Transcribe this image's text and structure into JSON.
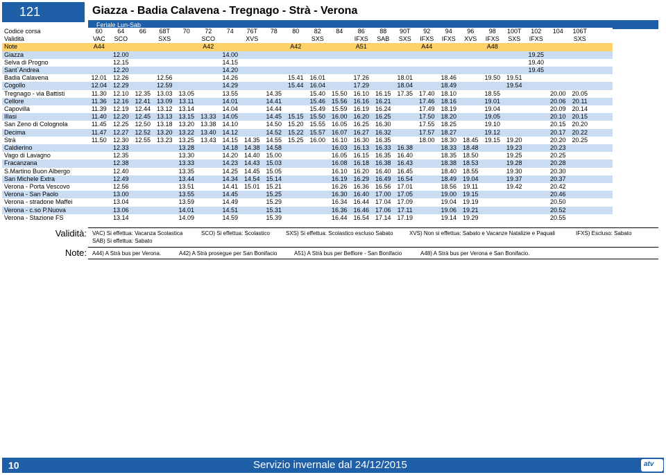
{
  "header": {
    "route_number": "121",
    "title": "Giazza - Badia Calavena - Tregnago - Strà - Verona",
    "service_days": "Feriale Lun-Sab"
  },
  "labels": {
    "course_code": "Codice corsa",
    "validity": "Validità",
    "notes": "Note"
  },
  "columns": 24,
  "course_codes": [
    "60",
    "64",
    "66",
    "68T",
    "70",
    "72",
    "74",
    "76T",
    "78",
    "80",
    "82",
    "84",
    "86",
    "88",
    "90T",
    "92",
    "94",
    "96",
    "98",
    "100T",
    "102",
    "104",
    "106T",
    ""
  ],
  "validity_row": [
    "VAC",
    "SCO",
    "",
    "SXS",
    "",
    "SCO",
    "",
    "XVS",
    "",
    "",
    "SXS",
    "",
    "IFXS",
    "SAB",
    "SXS",
    "IFXS",
    "IFXS",
    "XVS",
    "IFXS",
    "SXS",
    "IFXS",
    "",
    "SXS",
    ""
  ],
  "notes_row": [
    "A44",
    "",
    "",
    "",
    "",
    "A42",
    "",
    "",
    "",
    "A42",
    "",
    "",
    "A51",
    "",
    "",
    "A44",
    "",
    "",
    "A48",
    "",
    "",
    "",
    "",
    ""
  ],
  "stops": [
    {
      "name": "Giazza",
      "times": [
        "",
        "12.00",
        "",
        "",
        "",
        "",
        "14.00",
        "",
        "",
        "",
        "",
        "",
        "",
        "",
        "",
        "",
        "",
        "",
        "",
        "",
        "19.25",
        "",
        "",
        ""
      ]
    },
    {
      "name": "Selva di Progno",
      "times": [
        "",
        "12.15",
        "",
        "",
        "",
        "",
        "14.15",
        "",
        "",
        "",
        "",
        "",
        "",
        "",
        "",
        "",
        "",
        "",
        "",
        "",
        "19.40",
        "",
        "",
        ""
      ]
    },
    {
      "name": "Sant`Andrea",
      "times": [
        "",
        "12.20",
        "",
        "",
        "",
        "",
        "14.20",
        "",
        "",
        "",
        "",
        "",
        "",
        "",
        "",
        "",
        "",
        "",
        "",
        "",
        "19.45",
        "",
        "",
        ""
      ]
    },
    {
      "name": "Badia Calavena",
      "times": [
        "12.01",
        "12.26",
        "",
        "12.56",
        "",
        "",
        "14.26",
        "",
        "",
        "15.41",
        "16.01",
        "",
        "17.26",
        "",
        "18.01",
        "",
        "18.46",
        "",
        "19.50",
        "19.51",
        "",
        "",
        "",
        ""
      ]
    },
    {
      "name": "Cogollo",
      "times": [
        "12.04",
        "12.29",
        "",
        "12.59",
        "",
        "",
        "14.29",
        "",
        "",
        "15.44",
        "16.04",
        "",
        "17.29",
        "",
        "18.04",
        "",
        "18.49",
        "",
        "",
        "19.54",
        "",
        "",
        "",
        ""
      ]
    },
    {
      "name": "Tregnago - via Battisti",
      "times": [
        "11.30",
        "12.10",
        "12.35",
        "13.03",
        "13.05",
        "",
        "13.55",
        "",
        "14.35",
        "",
        "15.40",
        "15.50",
        "16.10",
        "16.15",
        "17.35",
        "17.40",
        "18.10",
        "",
        "18.55",
        "",
        "",
        "20.00",
        "20.05",
        ""
      ]
    },
    {
      "name": "Cellore",
      "times": [
        "11.36",
        "12.16",
        "12.41",
        "13.09",
        "13.11",
        "",
        "14.01",
        "",
        "14.41",
        "",
        "15.46",
        "15.56",
        "16.16",
        "16.21",
        "",
        "17.46",
        "18.16",
        "",
        "19.01",
        "",
        "",
        "20.06",
        "20.11",
        ""
      ]
    },
    {
      "name": "Capovilla",
      "times": [
        "11.39",
        "12.19",
        "12.44",
        "13.12",
        "13.14",
        "",
        "14.04",
        "",
        "14.44",
        "",
        "15.49",
        "15.59",
        "16.19",
        "16.24",
        "",
        "17.49",
        "18.19",
        "",
        "19.04",
        "",
        "",
        "20.09",
        "20.14",
        ""
      ]
    },
    {
      "name": "Illasi",
      "times": [
        "11.40",
        "12.20",
        "12.45",
        "13.13",
        "13.15",
        "13.33",
        "14.05",
        "",
        "14.45",
        "15.15",
        "15.50",
        "16.00",
        "16.20",
        "16.25",
        "",
        "17.50",
        "18.20",
        "",
        "19.05",
        "",
        "",
        "20.10",
        "20.15",
        ""
      ]
    },
    {
      "name": "San Zeno di Colognola",
      "times": [
        "11.45",
        "12.25",
        "12.50",
        "13.18",
        "13.20",
        "13.38",
        "14.10",
        "",
        "14.50",
        "15.20",
        "15.55",
        "16.05",
        "16.25",
        "16.30",
        "",
        "17.55",
        "18.25",
        "",
        "19.10",
        "",
        "",
        "20.15",
        "20.20",
        ""
      ]
    },
    {
      "name": "Decima",
      "times": [
        "11.47",
        "12.27",
        "12.52",
        "13.20",
        "13.22",
        "13.40",
        "14.12",
        "",
        "14.52",
        "15.22",
        "15.57",
        "16.07",
        "16.27",
        "16.32",
        "",
        "17.57",
        "18.27",
        "",
        "19.12",
        "",
        "",
        "20.17",
        "20.22",
        ""
      ]
    },
    {
      "name": "Strà",
      "times": [
        "11.50",
        "12.30",
        "12.55",
        "13.23",
        "13.25",
        "13.43",
        "14.15",
        "14.35",
        "14.55",
        "15.25",
        "16.00",
        "16.10",
        "16.30",
        "16.35",
        "",
        "18.00",
        "18.30",
        "18.45",
        "19.15",
        "19.20",
        "",
        "20.20",
        "20.25",
        ""
      ]
    },
    {
      "name": "Caldierino",
      "times": [
        "",
        "12.33",
        "",
        "",
        "13.28",
        "",
        "14.18",
        "14.38",
        "14.58",
        "",
        "",
        "16.03",
        "16.13",
        "16.33",
        "16.38",
        "",
        "18.33",
        "18.48",
        "",
        "19.23",
        "",
        "20.23",
        "",
        ""
      ]
    },
    {
      "name": "Vago di Lavagno",
      "times": [
        "",
        "12.35",
        "",
        "",
        "13.30",
        "",
        "14.20",
        "14.40",
        "15.00",
        "",
        "",
        "16.05",
        "16.15",
        "16.35",
        "16.40",
        "",
        "18.35",
        "18.50",
        "",
        "19.25",
        "",
        "20.25",
        "",
        ""
      ]
    },
    {
      "name": "Fracanzana",
      "times": [
        "",
        "12.38",
        "",
        "",
        "13.33",
        "",
        "14.23",
        "14.43",
        "15.03",
        "",
        "",
        "16.08",
        "16.18",
        "16.38",
        "16.43",
        "",
        "18.38",
        "18.53",
        "",
        "19.28",
        "",
        "20.28",
        "",
        ""
      ]
    },
    {
      "name": "S.Martino Buon Albergo",
      "times": [
        "",
        "12.40",
        "",
        "",
        "13.35",
        "",
        "14.25",
        "14.45",
        "15.05",
        "",
        "",
        "16.10",
        "16.20",
        "16.40",
        "16.45",
        "",
        "18.40",
        "18.55",
        "",
        "19.30",
        "",
        "20.30",
        "",
        ""
      ]
    },
    {
      "name": "San Michele Extra",
      "times": [
        "",
        "12.49",
        "",
        "",
        "13.44",
        "",
        "14.34",
        "14.54",
        "15.14",
        "",
        "",
        "16.19",
        "16.29",
        "16.49",
        "16.54",
        "",
        "18.49",
        "19.04",
        "",
        "19.37",
        "",
        "20.37",
        "",
        ""
      ]
    },
    {
      "name": "Verona - Porta Vescovo",
      "times": [
        "",
        "12.56",
        "",
        "",
        "13.51",
        "",
        "14.41",
        "15.01",
        "15.21",
        "",
        "",
        "16.26",
        "16.36",
        "16.56",
        "17.01",
        "",
        "18.56",
        "19.11",
        "",
        "19.42",
        "",
        "20.42",
        "",
        ""
      ]
    },
    {
      "name": "Verona - San Paolo",
      "times": [
        "",
        "13.00",
        "",
        "",
        "13.55",
        "",
        "14.45",
        "",
        "15.25",
        "",
        "",
        "16.30",
        "16.40",
        "17.00",
        "17.05",
        "",
        "19.00",
        "19.15",
        "",
        "",
        "",
        "20.46",
        "",
        ""
      ]
    },
    {
      "name": "Verona - stradone Maffei",
      "times": [
        "",
        "13.04",
        "",
        "",
        "13.59",
        "",
        "14.49",
        "",
        "15.29",
        "",
        "",
        "16.34",
        "16.44",
        "17.04",
        "17.09",
        "",
        "19.04",
        "19.19",
        "",
        "",
        "",
        "20.50",
        "",
        ""
      ]
    },
    {
      "name": "Verona - c.so P.Nuova",
      "times": [
        "",
        "13.06",
        "",
        "",
        "14.01",
        "",
        "14.51",
        "",
        "15.31",
        "",
        "",
        "16.36",
        "16.46",
        "17.06",
        "17.11",
        "",
        "19.06",
        "19.21",
        "",
        "",
        "",
        "20.52",
        "",
        ""
      ]
    },
    {
      "name": "Verona - Stazione FS",
      "times": [
        "",
        "13.14",
        "",
        "",
        "14.09",
        "",
        "14.59",
        "",
        "15.39",
        "",
        "",
        "16.44",
        "16.54",
        "17.14",
        "17.19",
        "",
        "19.14",
        "19.29",
        "",
        "",
        "",
        "20.55",
        "",
        ""
      ]
    }
  ],
  "legend": {
    "validity_label": "Validità:",
    "validity_items": [
      "VAC) Si effettua: Vacanza Scolastica",
      "SCO) Si effettua: Scolastico",
      "SXS) Si effettua: Scolastico escluso Sabato",
      "XVS) Non si effettua: Sabato e Vacanze Natalizie e Paquali",
      "IFXS) Escluso: Sabato"
    ],
    "validity_item_2": "SAB) Si effettua: Sabato",
    "note_label": "Note:",
    "note_items": [
      "A44) A Strà bus per Verona.",
      "A42) A Strà prosegue per San Bonifacio",
      "A51) A Strà bus per Belfiore - San Bonifacio",
      "A48) A Strà bus per Verona e San Bonifacio."
    ]
  },
  "footer": {
    "page_number": "10",
    "title": "Servizio invernale dal 24/12/2015",
    "logo_text": "atv"
  },
  "colors": {
    "brand_blue": "#1f5fa8",
    "row_blue": "#c9dcf2",
    "note_orange": "#ffd16b"
  }
}
